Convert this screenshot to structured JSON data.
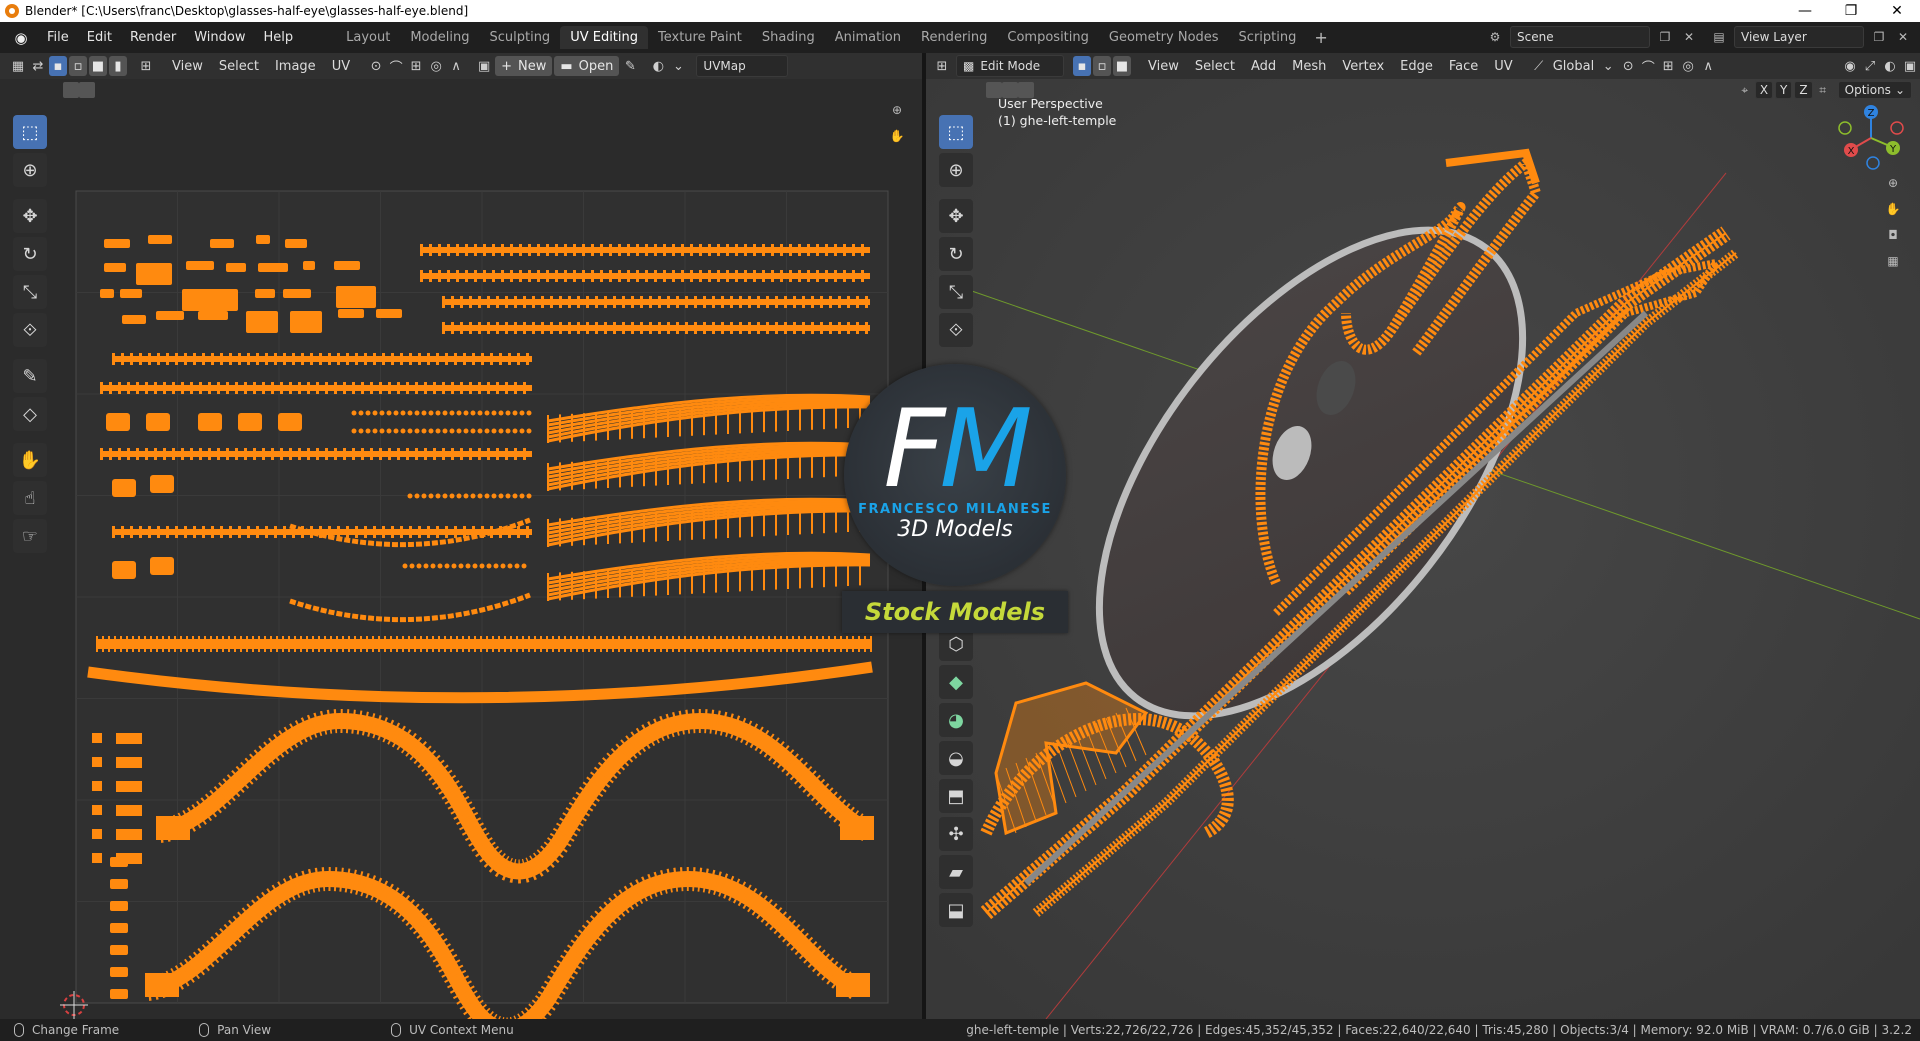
{
  "window": {
    "title": "Blender* [C:\\Users\\franc\\Desktop\\glasses-half-eye\\glasses-half-eye.blend]",
    "controls": [
      "—",
      "❐",
      "✕"
    ]
  },
  "menu": [
    "File",
    "Edit",
    "Render",
    "Window",
    "Help"
  ],
  "workspaces": [
    "Layout",
    "Modeling",
    "Sculpting",
    "UV Editing",
    "Texture Paint",
    "Shading",
    "Animation",
    "Rendering",
    "Compositing",
    "Geometry Nodes",
    "Scripting"
  ],
  "active_workspace": "UV Editing",
  "scene": {
    "name": "Scene",
    "view_layer": "View Layer"
  },
  "uv_editor": {
    "menus": [
      "View",
      "Select",
      "Image",
      "UV"
    ],
    "new_label": "New",
    "open_label": "Open",
    "uvmap": "UVMap"
  },
  "viewport": {
    "mode": "Edit Mode",
    "menus": [
      "View",
      "Select",
      "Add",
      "Mesh",
      "Vertex",
      "Edge",
      "Face",
      "UV"
    ],
    "orientation": "Global",
    "options_label": "Options",
    "axis_labels": [
      "X",
      "Y",
      "Z"
    ],
    "perspective": "User Perspective",
    "object": "(1) ghe-left-temple",
    "gizmo": {
      "x": "X",
      "y": "Y",
      "z": "Z"
    }
  },
  "watermark": {
    "f": "F",
    "m": "M",
    "author": "FRANCESCO MILANESE",
    "models": "3D Models",
    "stock": "Stock Models"
  },
  "statusbar": {
    "hint1": "Change Frame",
    "hint2": "Pan View",
    "hint3": "UV Context Menu",
    "stats": "ghe-left-temple | Verts:22,726/22,726 | Edges:45,352/45,352 | Faces:22,640/22,640 | Tris:45,280 | Objects:3/4 | Memory: 92.0 MiB | VRAM: 0.7/6.0 GiB | 3.2.2"
  },
  "colors": {
    "uv_orange": "#ff8a0f",
    "active_blue": "#4772b3",
    "logo_blue": "#1aa3e8",
    "stock_green": "#c5d93a"
  }
}
